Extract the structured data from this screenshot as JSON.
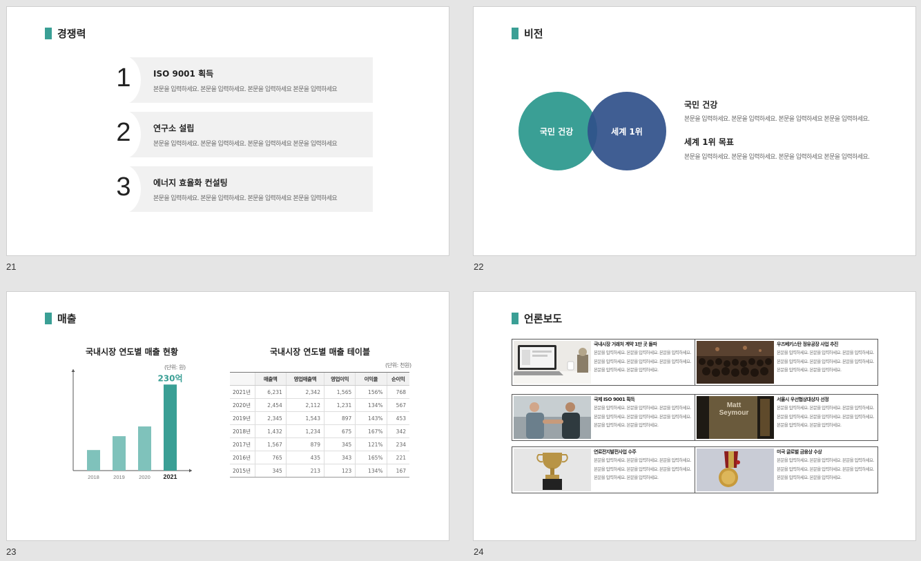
{
  "slides": [
    {
      "number": "21",
      "title": "경쟁력"
    },
    {
      "number": "22",
      "title": "비전"
    },
    {
      "number": "23",
      "title": "매출"
    },
    {
      "number": "24",
      "title": "언론보도"
    }
  ],
  "competitiveness": {
    "items": [
      {
        "num": "1",
        "head": "ISO 9001 획득",
        "body": "본문을 입력하세요. 본문을 입력하세요. 본문을 입력하세요 본문을 입력하세요"
      },
      {
        "num": "2",
        "head": "연구소 설립",
        "body": "본문을 입력하세요. 본문을 입력하세요. 본문을 입력하세요 본문을 입력하세요"
      },
      {
        "num": "3",
        "head": "에너지 효율화 컨설팅",
        "body": "본문을 입력하세요. 본문을 입력하세요. 본문을 입력하세요 본문을 입력하세요"
      }
    ]
  },
  "vision": {
    "circle_left": "국민 건강",
    "circle_right": "세계 1위",
    "items": [
      {
        "head": "국민 건강",
        "body": "본문을 입력하세요. 본문을 입력하세요. 본문을 입력하세요 본문을 입력하세요."
      },
      {
        "head": "세계 1위 목표",
        "body": "본문을 입력하세요. 본문을 입력하세요. 본문을 입력하세요 본문을 입력하세요."
      }
    ],
    "colors": {
      "teal": "#3a9f95",
      "navy": "#3e5d92"
    }
  },
  "sales": {
    "chart_title": "국내시장 연도별 매출 현황",
    "chart_unit": "(단위: 원)",
    "highlight_label": "230억",
    "table_title": "국내시장 연도별 매출 테이블",
    "table_unit": "(단위: 천원)",
    "columns": [
      "",
      "매출액",
      "영업매출액",
      "영업이익",
      "이익율",
      "순이익"
    ],
    "rows": [
      [
        "2021년",
        "6,231",
        "2,342",
        "1,565",
        "156%",
        "768"
      ],
      [
        "2020년",
        "2,454",
        "2,112",
        "1,231",
        "134%",
        "567"
      ],
      [
        "2019년",
        "2,345",
        "1,543",
        "897",
        "143%",
        "453"
      ],
      [
        "2018년",
        "1,432",
        "1,234",
        "675",
        "167%",
        "342"
      ],
      [
        "2017년",
        "1,567",
        "879",
        "345",
        "121%",
        "234"
      ],
      [
        "2016년",
        "765",
        "435",
        "343",
        "165%",
        "221"
      ],
      [
        "2015년",
        "345",
        "213",
        "123",
        "134%",
        "167"
      ]
    ]
  },
  "chart_data": {
    "type": "bar",
    "title": "국내시장 연도별 매출 현황",
    "categories": [
      "2018",
      "2019",
      "2020",
      "2021"
    ],
    "values": [
      55,
      92,
      118,
      230
    ],
    "ylim": [
      0,
      260
    ],
    "annotations": [
      {
        "category": "2021",
        "text": "230억"
      }
    ],
    "colors": [
      "#7fc2bb",
      "#7fc2bb",
      "#7fc2bb",
      "#3a9f95"
    ],
    "grid": false
  },
  "press": {
    "items": [
      {
        "title": "국내시장 거래처 계약 1만 곳 돌파",
        "body": "본문을 입력하세요. 본문을 입력하세요. 본문을 입력하세요. 본문을 입력하세요. 본문을 입력하세요. 본문을 입력하세요. 본문을 입력하세요. 본문을 입력하세요."
      },
      {
        "title": "우즈베키스탄 정유공장 사업 추진",
        "body": "본문을 입력하세요. 본문을 입력하세요. 본문을 입력하세요. 본문을 입력하세요. 본문을 입력하세요. 본문을 입력하세요. 본문을 입력하세요. 본문을 입력하세요."
      },
      {
        "title": "국제 ISO 9001 획득",
        "body": "본문을 입력하세요. 본문을 입력하세요. 본문을 입력하세요. 본문을 입력하세요. 본문을 입력하세요. 본문을 입력하세요. 본문을 입력하세요. 본문을 입력하세요."
      },
      {
        "title": "서울시 우선협상대상자 선정",
        "body": "본문을 입력하세요. 본문을 입력하세요. 본문을 입력하세요. 본문을 입력하세요. 본문을 입력하세요. 본문을 입력하세요. 본문을 입력하세요. 본문을 입력하세요."
      },
      {
        "title": "연료전지발전사업 수주",
        "body": "본문을 입력하세요. 본문을 입력하세요. 본문을 입력하세요. 본문을 입력하세요. 본문을 입력하세요. 본문을 입력하세요. 본문을 입력하세요. 본문을 입력하세요."
      },
      {
        "title": "미국 글로벌 금융상 수상",
        "body": "본문을 입력하세요. 본문을 입력하세요. 본문을 입력하세요. 본문을 입력하세요. 본문을 입력하세요. 본문을 입력하세요. 본문을 입력하세요. 본문을 입력하세요."
      }
    ],
    "photo_text": "Matt Seymour"
  }
}
